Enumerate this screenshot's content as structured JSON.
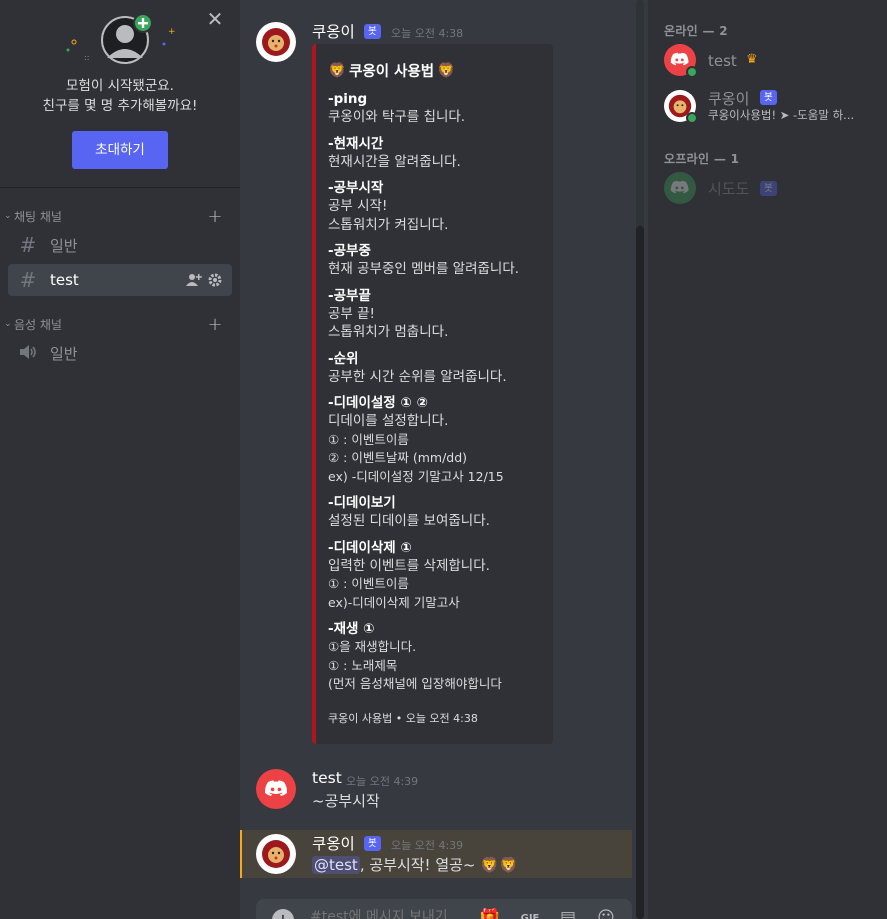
{
  "invite_panel": {
    "close_glyph": "✕",
    "line1": "모험이 시작됐군요.",
    "line2": "친구를 몇 명 추가해볼까요!",
    "button_label": "초대하기"
  },
  "sidebar": {
    "text_category": "채팅 채널",
    "voice_category": "음성 채널",
    "add_glyph": "+",
    "channels": [
      {
        "name": "일반",
        "icon": "#"
      },
      {
        "name": "test",
        "icon": "#"
      }
    ],
    "voice_channels": [
      {
        "name": "일반",
        "icon": "speaker-icon"
      }
    ]
  },
  "chat": {
    "messages": [
      {
        "author": "쿠옹이",
        "bot_tag": "봇",
        "time": "오늘 오전 4:38",
        "embed": {
          "title": "쿠옹이 사용법",
          "commands": [
            {
              "name": "-ping",
              "lines": [
                "쿠옹이와 탁구를 칩니다."
              ]
            },
            {
              "name": "-현재시간",
              "lines": [
                "현재시간을 알려줍니다."
              ]
            },
            {
              "name": "-공부시작",
              "lines": [
                "공부 시작!",
                "스톱워치가 켜집니다."
              ]
            },
            {
              "name": "-공부중",
              "lines": [
                "현재 공부중인 멤버를 알려줍니다."
              ]
            },
            {
              "name": "-공부끝",
              "lines": [
                "공부 끝!",
                "스톱워치가 멈춥니다."
              ]
            },
            {
              "name": "-순위",
              "lines": [
                "공부한 시간 순위를 알려줍니다."
              ]
            },
            {
              "name": "-디데이설정 ① ②",
              "lines": [
                "디데이를 설정합니다.",
                "① : 이벤트이름",
                "② : 이벤트날짜 (mm/dd)",
                "ex) -디데이설정 기말고사 12/15"
              ]
            },
            {
              "name": "-디데이보기",
              "lines": [
                "설정된 디데이를 보여줍니다."
              ]
            },
            {
              "name": "-디데이삭제 ①",
              "lines": [
                "입력한 이벤트를 삭제합니다.",
                "① : 이벤트이름",
                "ex)-디데이삭제 기말고사"
              ]
            },
            {
              "name": "-재생 ①",
              "lines": [
                "①을 재생합니다.",
                "① : 노래제목",
                "(먼저 음성채널에 입장해야합니다"
              ]
            }
          ],
          "footer": "쿠옹이 사용법 • 오늘 오전 4:38",
          "accent_color": "#b0141c"
        }
      },
      {
        "author": "test",
        "time": "오늘 오전 4:39",
        "text": "~공부시작"
      },
      {
        "author": "쿠옹이",
        "bot_tag": "봇",
        "time": "오늘 오전 4:39",
        "mention": "@test",
        "text": ", 공부시작! 열공~"
      }
    ],
    "composer": {
      "placeholder": "#test에 메시지 보내기",
      "upload_glyph": "+",
      "icons": [
        "gift-icon",
        "gif-icon",
        "sticker-icon",
        "emoji-icon"
      ]
    }
  },
  "members": {
    "online_header": "온라인 — 2",
    "offline_header": "오프라인 — 1",
    "online": [
      {
        "name": "test",
        "badge": "crown-icon"
      },
      {
        "name": "쿠옹이",
        "bot_tag": "봇",
        "status": "쿠옹이사용법! ➤ -도움말 하..."
      }
    ],
    "offline": [
      {
        "name": "시도도",
        "bot_tag": "봇"
      }
    ]
  },
  "colors": {
    "blurple": "#5865f2",
    "online_green": "#3ba55c",
    "mention_highlight": "#faa81a",
    "discord_red": "#ed4245"
  }
}
